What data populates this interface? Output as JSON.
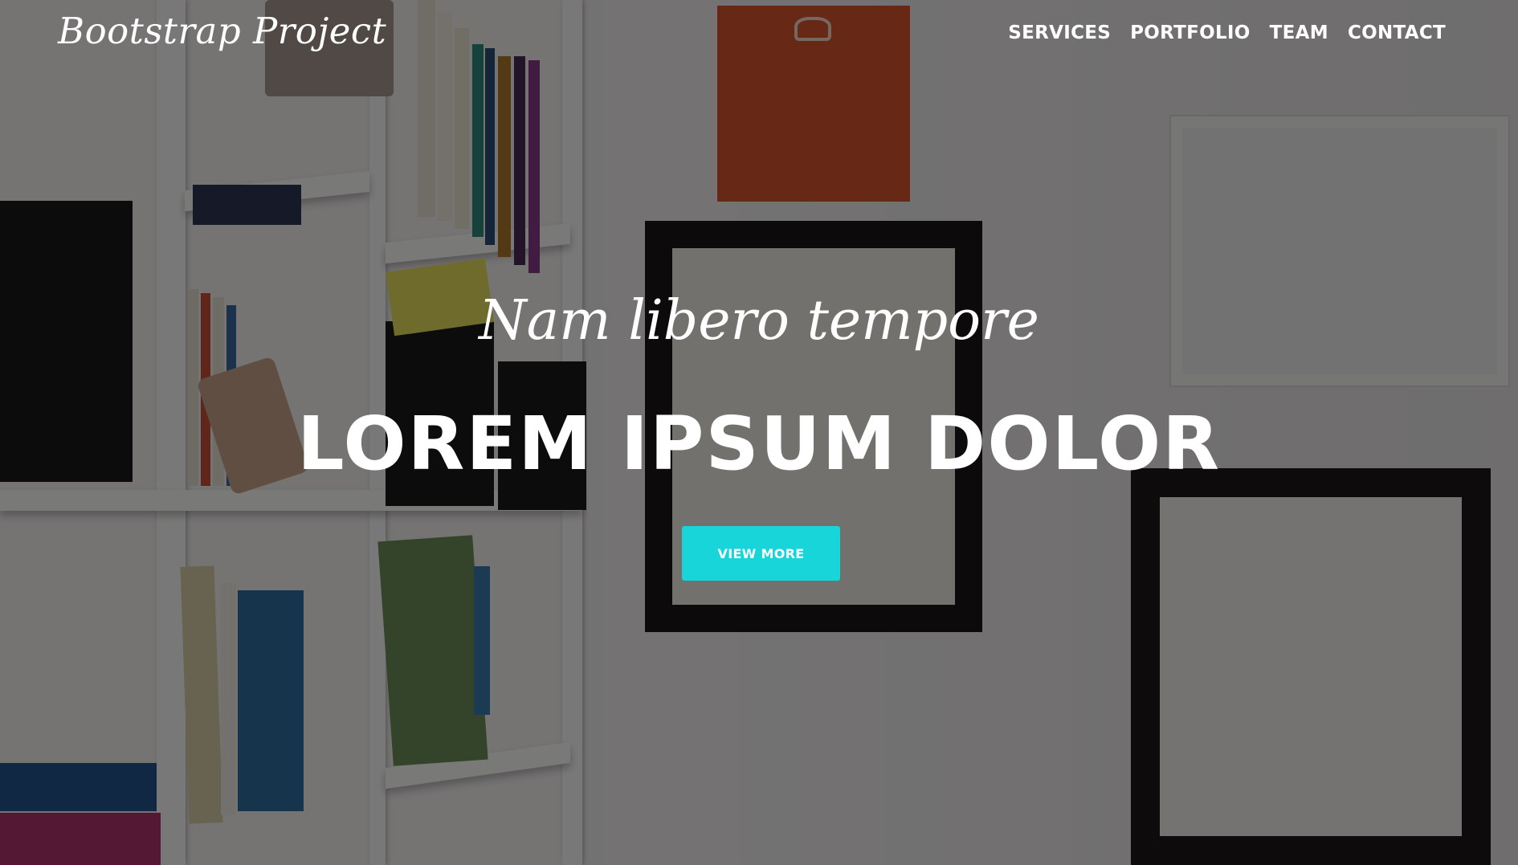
{
  "navbar": {
    "brand": "Bootstrap Project",
    "links": [
      "SERVICES",
      "PORTFOLIO",
      "TEAM",
      "CONTACT"
    ]
  },
  "hero": {
    "subheading": "Nam libero tempore",
    "heading": "LOREM IPSUM DOLOR",
    "button_label": "VIEW MORE"
  },
  "colors": {
    "accent": "#17d5d8",
    "overlay": "rgba(0,0,0,0.52)",
    "text": "#ffffff"
  }
}
